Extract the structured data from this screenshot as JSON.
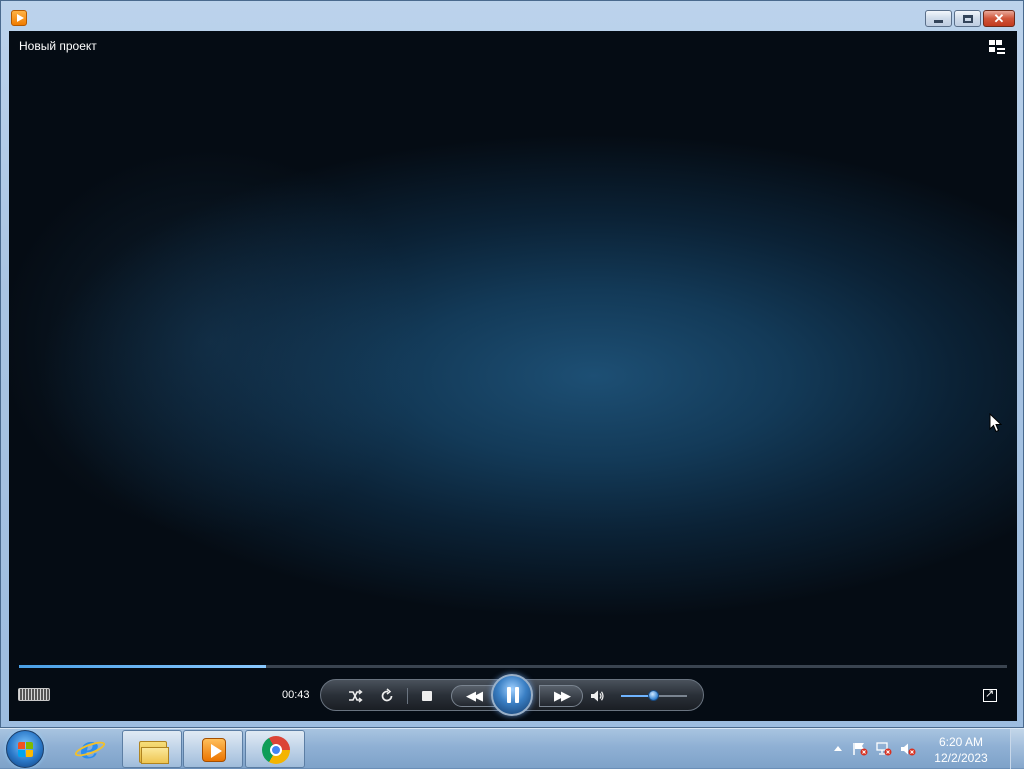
{
  "window": {
    "title_icon": "media-player-icon",
    "controls": {
      "minimize": "minimize",
      "maximize": "maximize",
      "close": "close"
    }
  },
  "player": {
    "now_playing_title": "Новый проект",
    "elapsed_time": "00:43",
    "seek_progress_fraction": 0.25,
    "volume_fraction": 0.48,
    "accent_color": "#4aa0e6"
  },
  "controls": {
    "shuffle_icon": "shuffle-icon",
    "repeat_icon": "repeat-icon",
    "stop_icon": "stop-icon",
    "previous_icon": "rewind-icon",
    "play_pause_icon": "pause-icon",
    "next_icon": "fast-forward-icon",
    "mute_icon": "speaker-icon"
  },
  "taskbar": {
    "pinned": [
      "internet-explorer",
      "windows-explorer",
      "windows-media-player",
      "google-chrome"
    ],
    "clock_time": "6:20 AM",
    "clock_date": "12/2/2023"
  }
}
